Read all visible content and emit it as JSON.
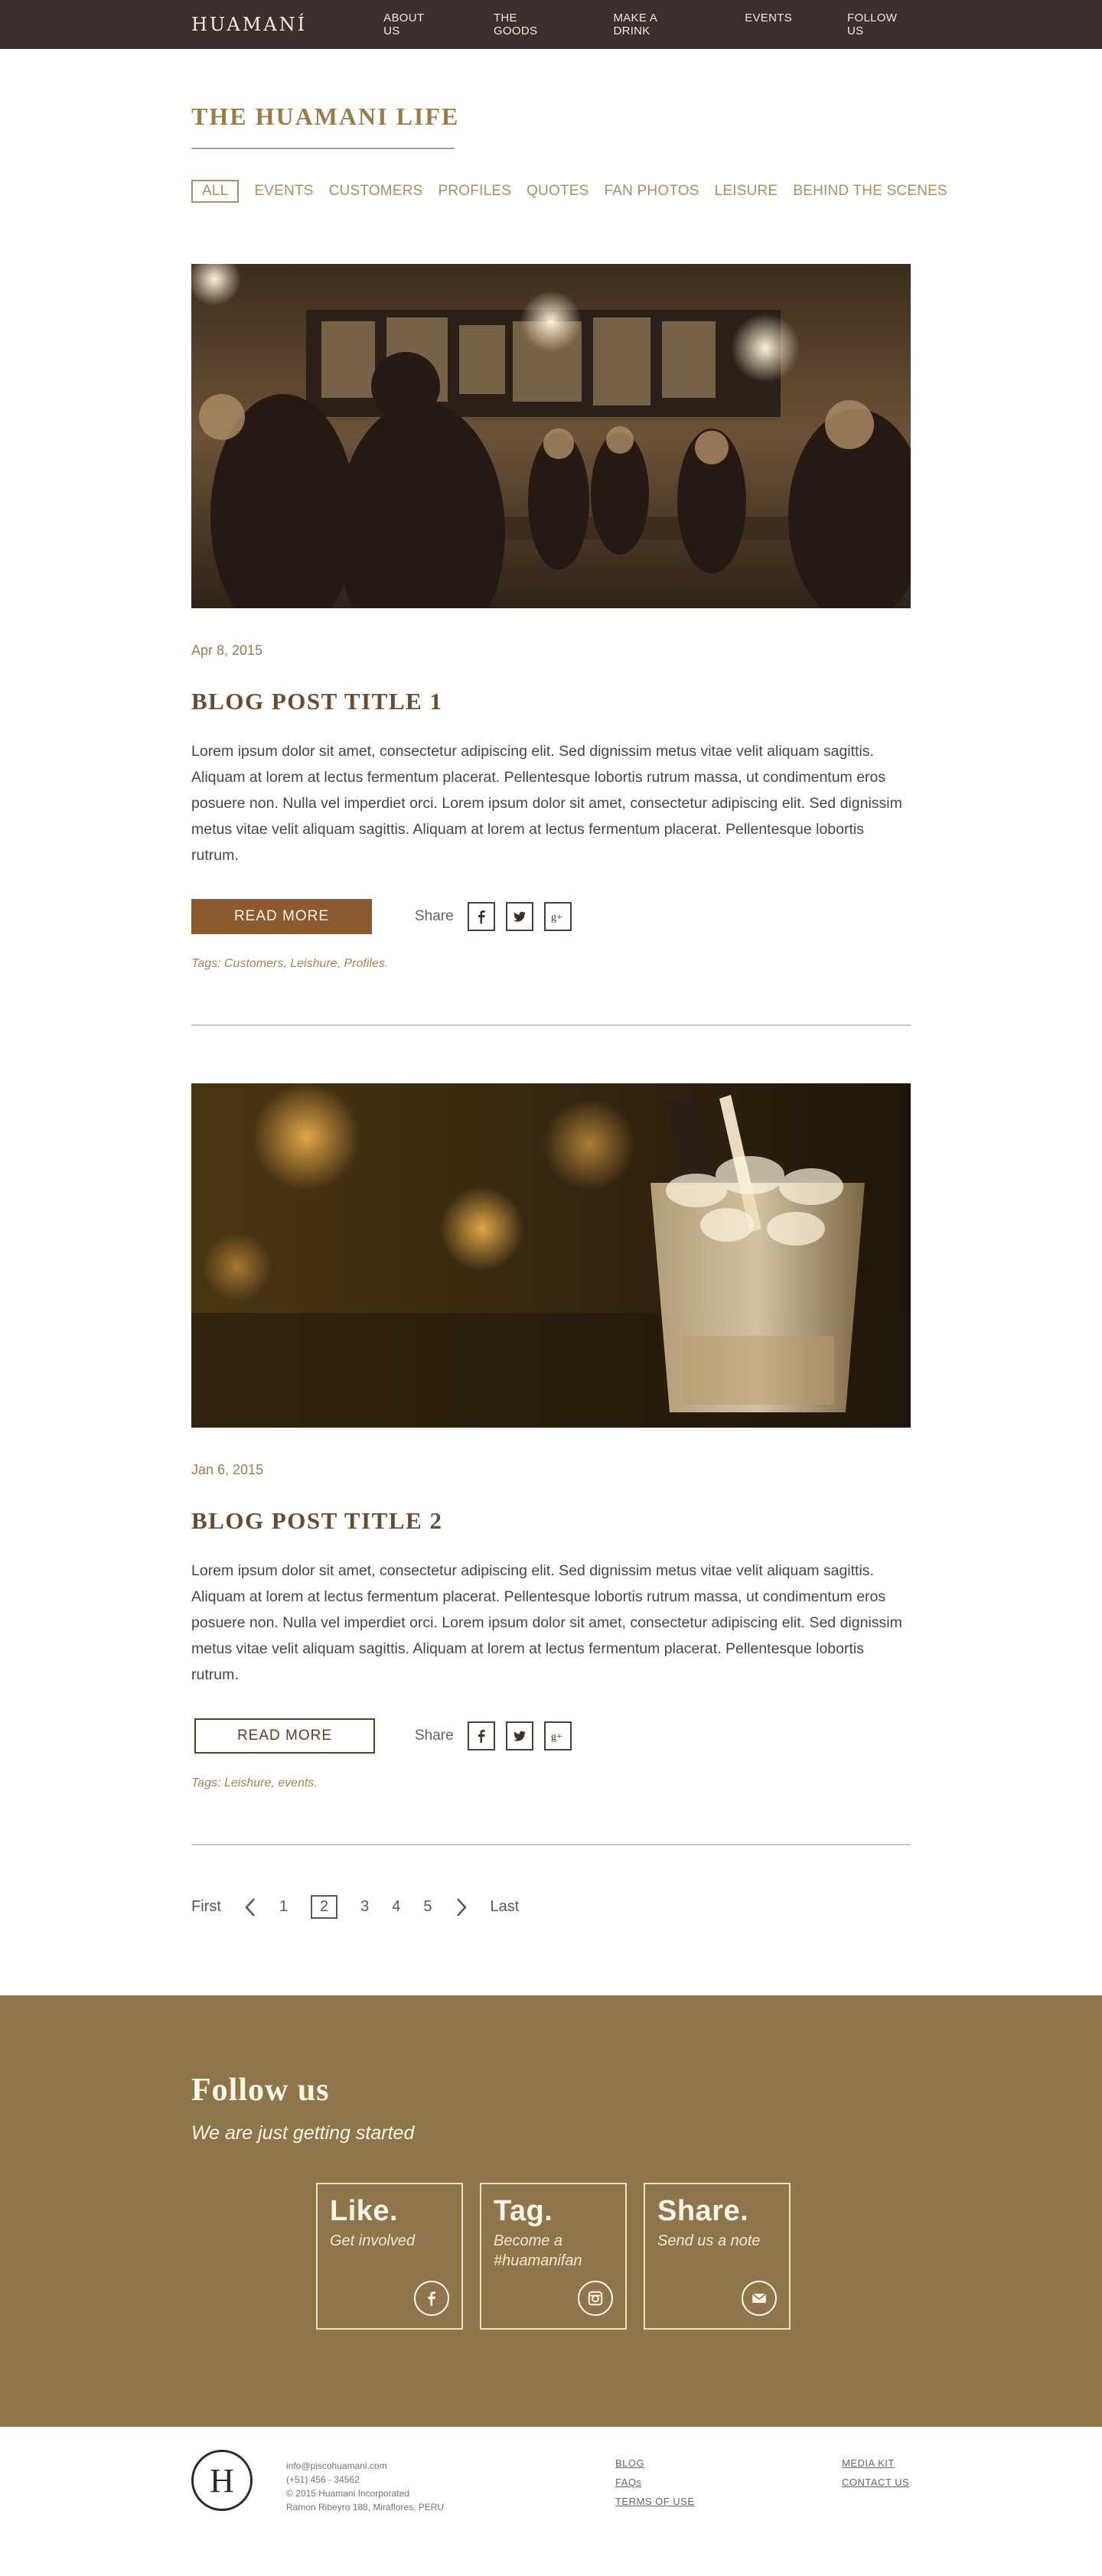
{
  "brand": {
    "logo": "HUAMANÍ"
  },
  "nav": {
    "items": [
      {
        "label": "ABOUT US"
      },
      {
        "label": "THE GOODS"
      },
      {
        "label": "MAKE A DRINK"
      },
      {
        "label": "EVENTS"
      },
      {
        "label": "FOLLOW US"
      }
    ]
  },
  "header": {
    "title": "THE HUAMANI LIFE",
    "filters": [
      {
        "label": "ALL",
        "active": true
      },
      {
        "label": "EVENTS"
      },
      {
        "label": "CUSTOMERS"
      },
      {
        "label": "PROFILES"
      },
      {
        "label": "QUOTES"
      },
      {
        "label": "FAN PHOTOS"
      },
      {
        "label": "LEISURE"
      },
      {
        "label": "BEHIND THE SCENES"
      }
    ]
  },
  "posts": [
    {
      "date": "Apr 8, 2015",
      "title": "BLOG POST TITLE 1",
      "excerpt": "Lorem ipsum dolor sit amet, consectetur adipiscing elit. Sed dignissim metus vitae velit aliquam sagittis. Aliquam at lorem at lectus fermentum placerat. Pellentesque lobortis rutrum massa, ut condimentum eros posuere non. Nulla vel imperdiet orci. Lorem ipsum dolor sit amet, consectetur adipiscing elit. Sed dignissim metus vitae velit aliquam sagittis. Aliquam at lorem at lectus fermentum placerat. Pellentesque lobortis rutrum.",
      "read_more": "READ MORE",
      "share_label": "Share",
      "tags_label": "Tags:",
      "tags": "Customers, Leishure, Profiles."
    },
    {
      "date": "Jan 6, 2015",
      "title": "BLOG POST TITLE 2",
      "excerpt": "Lorem ipsum dolor sit amet, consectetur adipiscing elit. Sed dignissim metus vitae velit aliquam sagittis. Aliquam at lorem at lectus fermentum placerat. Pellentesque lobortis rutrum massa, ut condimentum eros posuere non. Nulla vel imperdiet orci. Lorem ipsum dolor sit amet, consectetur adipiscing elit. Sed dignissim metus vitae velit aliquam sagittis. Aliquam at lorem at lectus fermentum placerat. Pellentesque lobortis rutrum.",
      "read_more": "READ MORE",
      "share_label": "Share",
      "tags_label": "Tags:",
      "tags": "Leishure, events."
    }
  ],
  "pagination": {
    "first": "First",
    "pages": [
      "1",
      "2",
      "3",
      "4",
      "5"
    ],
    "current": "2",
    "last": "Last"
  },
  "follow": {
    "title": "Follow us",
    "subtitle": "We are just getting started",
    "cards": [
      {
        "heading": "Like.",
        "text": "Get involved",
        "icon": "facebook-icon"
      },
      {
        "heading": "Tag.",
        "text": "Become a #huamanifan",
        "icon": "instagram-icon"
      },
      {
        "heading": "Share.",
        "text": "Send us a note",
        "icon": "mail-icon"
      }
    ]
  },
  "footer": {
    "badge": "H",
    "email": "info@piscohuamani.com",
    "phone": "(+51) 456 - 34562",
    "copyright": "© 2015 Huamani Incorporated",
    "address": "Ramon Ribeyro 188, Miraflores, PERU",
    "links_a": [
      "BLOG",
      "FAQs",
      "TERMS OF USE"
    ],
    "links_b": [
      "MEDIA KIT",
      "CONTACT US"
    ]
  },
  "colors": {
    "topbar": "#3a2f2c",
    "accent": "#8c5a2f",
    "follow_bg": "#8f764a"
  }
}
